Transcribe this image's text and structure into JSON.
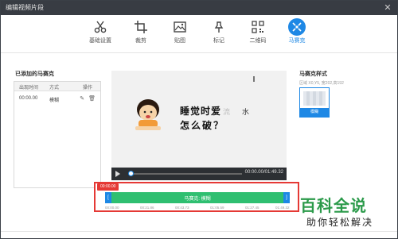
{
  "window": {
    "title": "编辑视频片段",
    "close_glyph": "✕"
  },
  "toolbar": {
    "items": [
      {
        "label": "基础设置",
        "icon": "scissors-icon"
      },
      {
        "label": "裁剪",
        "icon": "crop-icon"
      },
      {
        "label": "贴图",
        "icon": "image-icon"
      },
      {
        "label": "标记",
        "icon": "pin-icon"
      },
      {
        "label": "二维码",
        "icon": "qrcode-icon"
      },
      {
        "label": "马赛克",
        "icon": "mosaic-icon",
        "active": true
      }
    ],
    "accent": "#1e88e5"
  },
  "left": {
    "title": "已添加的马赛克",
    "columns": [
      "出现时间",
      "方式",
      "操作"
    ],
    "rows": [
      {
        "time": "00:00.00",
        "mode": "模糊",
        "edit_glyph": "✎",
        "delete_glyph": "🗑"
      }
    ]
  },
  "preview": {
    "caption_line1": "睡觉时爱",
    "caption_faint": "流",
    "caption_faint2": "水",
    "caption_line2": "怎么破？"
  },
  "player": {
    "time": "00:00.00/01:49.32"
  },
  "right": {
    "title": "马赛克样式",
    "subtitle": "区域 X0,Y5, 宽202,高192",
    "style_label": "模糊"
  },
  "timeline": {
    "current_time": "00:00.00",
    "track_label": "马赛克: 模糊",
    "ticks": [
      "00:00.00",
      "00:21.86",
      "00:43.73",
      "01:05.59",
      "01:27.45",
      "01:49.32"
    ],
    "border_color": "#e53935",
    "track_color": "#2fbf71"
  },
  "watermark": {
    "big": "百科全说",
    "small": "助你轻松解决"
  }
}
